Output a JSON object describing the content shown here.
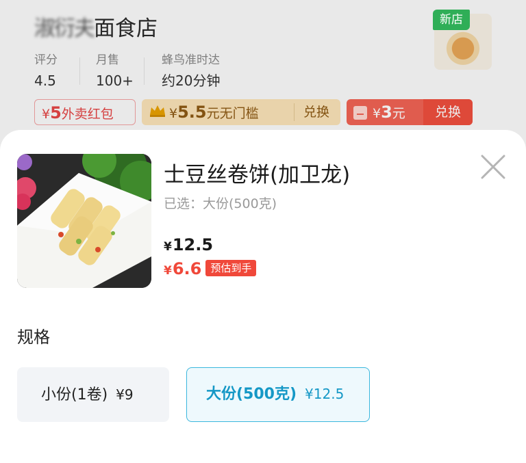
{
  "store": {
    "name_blurred": "淑衍夫",
    "name_visible": "面食店",
    "new_badge": "新店",
    "stats": [
      {
        "label": "评分",
        "value": "4.5"
      },
      {
        "label": "月售",
        "value": "100+"
      },
      {
        "label": "蜂鸟准时达",
        "value": "约20分钟"
      }
    ],
    "coupons": {
      "red_packet": {
        "currency": "¥",
        "amount": "5",
        "text": "外卖红包"
      },
      "member": {
        "currency": "¥",
        "amount": "5.5",
        "text": "元无门槛",
        "action": "兑换"
      },
      "voucher": {
        "currency": "¥",
        "amount": "3",
        "unit": "元",
        "action": "兑换"
      }
    }
  },
  "product": {
    "title": "士豆丝卷饼(加卫龙)",
    "selected": "已选：大份(500克)",
    "price_currency": "¥",
    "price": "12.5",
    "estimate_currency": "¥",
    "estimate": "6.6",
    "estimate_tag": "预估到手"
  },
  "spec": {
    "label": "规格",
    "options": [
      {
        "name": "小份(1卷)",
        "price": "¥9",
        "selected": false
      },
      {
        "name": "大份(500克)",
        "price": "¥12.5",
        "selected": true
      }
    ]
  },
  "icons": {
    "close": "close-icon",
    "crown": "crown-icon",
    "envelope": "red-envelope-icon"
  },
  "colors": {
    "accent_blue": "#3ab7dd",
    "price_red": "#f0483a",
    "new_badge_green": "#2fae57"
  }
}
